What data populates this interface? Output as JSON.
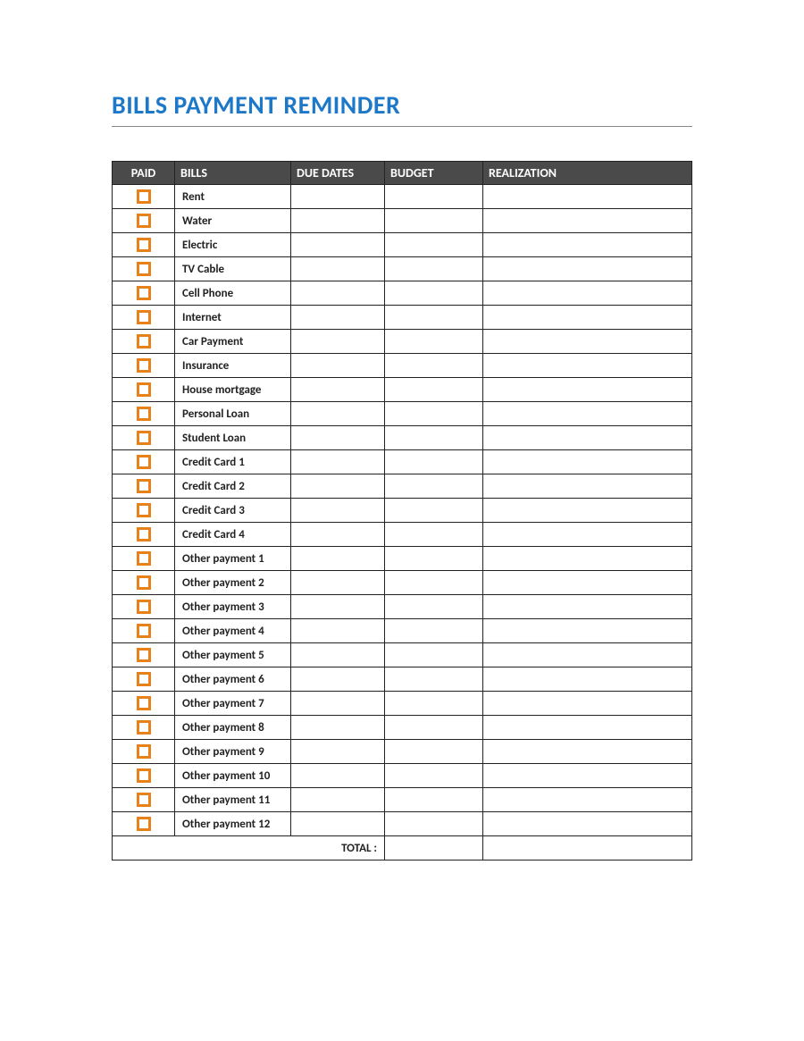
{
  "title": "BILLS PAYMENT REMINDER",
  "columns": {
    "paid": "PAID",
    "bills": "BILLS",
    "due_dates": "DUE DATES",
    "budget": "BUDGET",
    "realization": "REALIZATION"
  },
  "rows": [
    {
      "paid": false,
      "bill": "Rent",
      "due_date": "",
      "budget": "",
      "realization": ""
    },
    {
      "paid": false,
      "bill": "Water",
      "due_date": "",
      "budget": "",
      "realization": ""
    },
    {
      "paid": false,
      "bill": "Electric",
      "due_date": "",
      "budget": "",
      "realization": ""
    },
    {
      "paid": false,
      "bill": "TV Cable",
      "due_date": "",
      "budget": "",
      "realization": ""
    },
    {
      "paid": false,
      "bill": "Cell Phone",
      "due_date": "",
      "budget": "",
      "realization": ""
    },
    {
      "paid": false,
      "bill": "Internet",
      "due_date": "",
      "budget": "",
      "realization": ""
    },
    {
      "paid": false,
      "bill": "Car Payment",
      "due_date": "",
      "budget": "",
      "realization": ""
    },
    {
      "paid": false,
      "bill": "Insurance",
      "due_date": "",
      "budget": "",
      "realization": ""
    },
    {
      "paid": false,
      "bill": "House mortgage",
      "due_date": "",
      "budget": "",
      "realization": ""
    },
    {
      "paid": false,
      "bill": "Personal Loan",
      "due_date": "",
      "budget": "",
      "realization": ""
    },
    {
      "paid": false,
      "bill": "Student Loan",
      "due_date": "",
      "budget": "",
      "realization": ""
    },
    {
      "paid": false,
      "bill": "Credit Card 1",
      "due_date": "",
      "budget": "",
      "realization": ""
    },
    {
      "paid": false,
      "bill": "Credit Card 2",
      "due_date": "",
      "budget": "",
      "realization": ""
    },
    {
      "paid": false,
      "bill": "Credit Card 3",
      "due_date": "",
      "budget": "",
      "realization": ""
    },
    {
      "paid": false,
      "bill": "Credit Card 4",
      "due_date": "",
      "budget": "",
      "realization": ""
    },
    {
      "paid": false,
      "bill": "Other payment 1",
      "due_date": "",
      "budget": "",
      "realization": ""
    },
    {
      "paid": false,
      "bill": "Other payment 2",
      "due_date": "",
      "budget": "",
      "realization": ""
    },
    {
      "paid": false,
      "bill": "Other payment 3",
      "due_date": "",
      "budget": "",
      "realization": ""
    },
    {
      "paid": false,
      "bill": "Other payment 4",
      "due_date": "",
      "budget": "",
      "realization": ""
    },
    {
      "paid": false,
      "bill": "Other payment 5",
      "due_date": "",
      "budget": "",
      "realization": ""
    },
    {
      "paid": false,
      "bill": "Other payment 6",
      "due_date": "",
      "budget": "",
      "realization": ""
    },
    {
      "paid": false,
      "bill": "Other payment 7",
      "due_date": "",
      "budget": "",
      "realization": ""
    },
    {
      "paid": false,
      "bill": "Other payment 8",
      "due_date": "",
      "budget": "",
      "realization": ""
    },
    {
      "paid": false,
      "bill": "Other payment 9",
      "due_date": "",
      "budget": "",
      "realization": ""
    },
    {
      "paid": false,
      "bill": "Other payment 10",
      "due_date": "",
      "budget": "",
      "realization": ""
    },
    {
      "paid": false,
      "bill": "Other payment 11",
      "due_date": "",
      "budget": "",
      "realization": ""
    },
    {
      "paid": false,
      "bill": "Other payment 12",
      "due_date": "",
      "budget": "",
      "realization": ""
    }
  ],
  "total_label": "TOTAL :",
  "total_budget": "",
  "total_realization": ""
}
